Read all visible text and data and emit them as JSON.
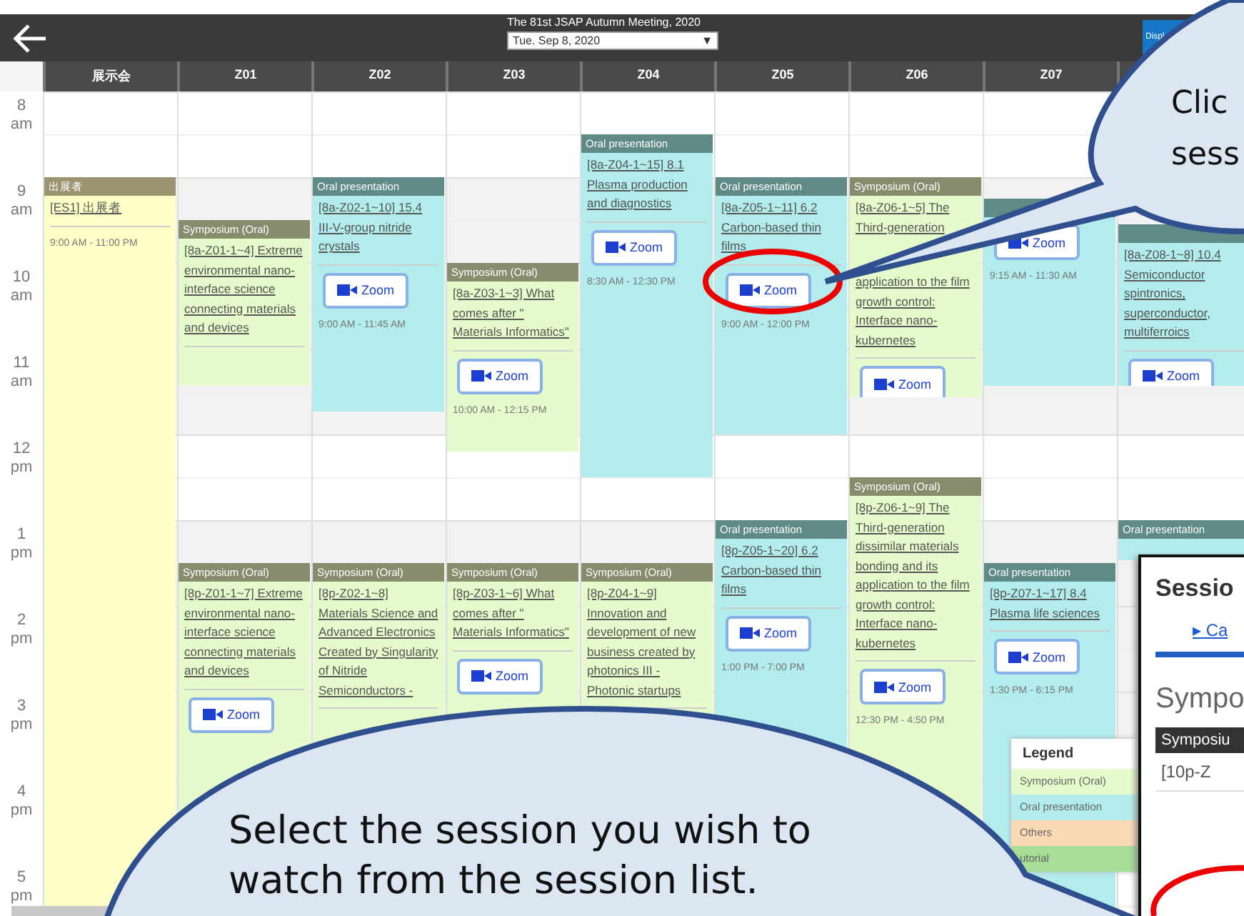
{
  "header": {
    "title": "The 81st JSAP Autumn Meeting, 2020",
    "date_select": "Tue. Sep 8, 2020",
    "dropdown_arrow": "▼",
    "display_button": "Displ"
  },
  "hours": [
    {
      "hour": "8",
      "period": "am"
    },
    {
      "hour": "9",
      "period": "am"
    },
    {
      "hour": "10",
      "period": "am"
    },
    {
      "hour": "11",
      "period": "am"
    },
    {
      "hour": "12",
      "period": "pm"
    },
    {
      "hour": "1",
      "period": "pm"
    },
    {
      "hour": "2",
      "period": "pm"
    },
    {
      "hour": "3",
      "period": "pm"
    },
    {
      "hour": "4",
      "period": "pm"
    },
    {
      "hour": "5",
      "period": "pm"
    }
  ],
  "columns": [
    {
      "name": "展示会",
      "events": [
        {
          "kind": "exhibit",
          "category": "出展者",
          "title": "[ES1] 出展者",
          "time": "9:00 AM - 11:00 PM"
        }
      ]
    },
    {
      "name": "Z01",
      "events": [
        {
          "kind": "symposium",
          "category": "Symposium (Oral)",
          "title": "[8a-Z01-1~4] Extreme environmental nano-interface science connecting materials and devices"
        },
        {
          "kind": "symposium",
          "category": "Symposium (Oral)",
          "title": "[8p-Z01-1~7] Extreme environmental nano-interface science connecting materials and devices",
          "zoom": "Zoom"
        }
      ]
    },
    {
      "name": "Z02",
      "events": [
        {
          "kind": "oral",
          "category": "Oral presentation",
          "title": "[8a-Z02-1~10] 15.4 III-V-group nitride crystals",
          "zoom": "Zoom",
          "time": "9:00 AM - 11:45 AM"
        },
        {
          "kind": "symposium",
          "category": "Symposium (Oral)",
          "title": "[8p-Z02-1~8] Materials Science and Advanced Electronics Created by Singularity of Nitride Semiconductors -"
        }
      ]
    },
    {
      "name": "Z03",
      "events": [
        {
          "kind": "symposium",
          "category": "Symposium (Oral)",
          "title": "[8a-Z03-1~3] What comes after \" Materials Informatics\"",
          "zoom": "Zoom",
          "time": "10:00 AM - 12:15 PM"
        },
        {
          "kind": "symposium",
          "category": "Symposium (Oral)",
          "title": "[8p-Z03-1~6] What comes after \" Materials Informatics\"",
          "zoom": "Zoom"
        }
      ]
    },
    {
      "name": "Z04",
      "events": [
        {
          "kind": "oral",
          "category": "Oral presentation",
          "title": "[8a-Z04-1~15] 8.1 Plasma production and diagnostics",
          "zoom": "Zoom",
          "time": "8:30 AM - 12:30 PM"
        },
        {
          "kind": "symposium",
          "category": "Symposium (Oral)",
          "title": "[8p-Z04-1~9] Innovation and development of new business created by photonics III - Photonic startups"
        }
      ]
    },
    {
      "name": "Z05",
      "events": [
        {
          "kind": "oral",
          "category": "Oral presentation",
          "title": "[8a-Z05-1~11] 6.2 Carbon-based thin films",
          "zoom": "Zoom",
          "time": "9:00 AM - 12:00 PM"
        },
        {
          "kind": "oral",
          "category": "Oral presentation",
          "title": "[8p-Z05-1~20] 6.2 Carbon-based thin films",
          "zoom": "Zoom",
          "time": "1:00 PM - 7:00 PM"
        }
      ]
    },
    {
      "name": "Z06",
      "events": [
        {
          "kind": "symposium",
          "category": "Symposium (Oral)",
          "title": "[8a-Z06-1~5] The Third-generation",
          "title_continued": "application to the film growth control: Interface nano-kubernetes",
          "zoom": "Zoom"
        },
        {
          "kind": "symposium",
          "category": "Symposium (Oral)",
          "title": "[8p-Z06-1~9] The Third-generation dissimilar materials bonding and its application to the film growth control: Interface nano-kubernetes",
          "zoom": "Zoom",
          "time": "12:30 PM - 4:50 PM"
        }
      ]
    },
    {
      "name": "Z07",
      "events": [
        {
          "kind": "oral",
          "zoom": "Zoom",
          "time": "9:15 AM - 11:30 AM"
        },
        {
          "kind": "oral",
          "category": "Oral presentation",
          "title": "[8p-Z07-1~17] 8.4 Plasma life sciences",
          "zoom": "Zoom",
          "time": "1:30 PM - 6:15 PM"
        }
      ]
    },
    {
      "events": [
        {
          "kind": "oral",
          "title": "[8a-Z08-1~8] 10.4 Semiconductor spintronics, superconductor, multiferroics",
          "zoom": "Zoom"
        },
        {
          "kind": "oral",
          "category": "Oral presentation"
        }
      ]
    }
  ],
  "legend": {
    "title": "Legend",
    "items": [
      {
        "label": "Symposium (Oral)",
        "color": "#e6fbcc"
      },
      {
        "label": "Oral presentation",
        "color": "#b2ecec"
      },
      {
        "label": "Others",
        "color": "#fbd9b5"
      },
      {
        "label": "utorial",
        "color": "#a6dd97"
      }
    ]
  },
  "session_panel": {
    "title": "Sessio",
    "link": "▸ Ca",
    "heading": "Sympo",
    "table_header": "Symposiu",
    "row": "[10p-Z"
  },
  "callouts": [
    {
      "kind": "top",
      "lines": [
        "Clic",
        "sess"
      ]
    },
    {
      "kind": "bottom",
      "lines": [
        "Select the session you wish to",
        "watch from the session list."
      ]
    }
  ]
}
